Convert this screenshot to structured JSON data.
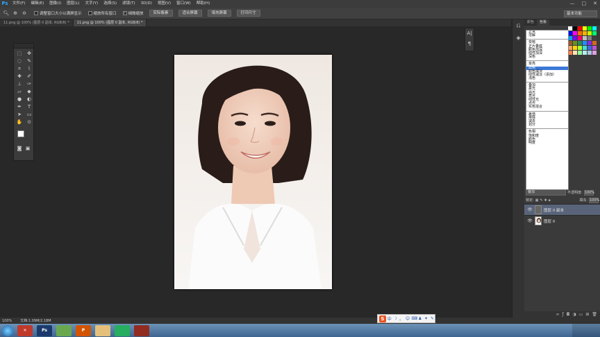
{
  "app": {
    "logo": "Ps"
  },
  "menu": [
    "文件(F)",
    "编辑(E)",
    "图像(I)",
    "图层(L)",
    "文字(Y)",
    "选择(S)",
    "滤镜(T)",
    "3D(D)",
    "视图(V)",
    "窗口(W)",
    "帮助(H)"
  ],
  "window_controls": {
    "minimize": "—",
    "maximize": "□",
    "close": "✕"
  },
  "options": {
    "check1": "调整窗口大小以满屏显示",
    "check2": "缩放所有窗口",
    "check3": "细微缩放",
    "btn1": "实际像素",
    "btn2": "适合屏幕",
    "btn3": "填充屏幕",
    "btn4": "打印尺寸",
    "workspace": "基本功能"
  },
  "tabs": [
    "11.png @ 100% (图层 0 副本, RGB/8) *",
    "11.png @ 100% (图层 0 副本, RGB/8) *"
  ],
  "strip": {
    "a": "A|",
    "b": "¶"
  },
  "right_panel": {
    "tab1": "颜色",
    "tab2": "色板"
  },
  "swatch_colors": [
    "#ffffff",
    "#000000",
    "#ff0000",
    "#ffff00",
    "#00ff00",
    "#00ffff",
    "#0000ff",
    "#ff00ff",
    "#ff6f00",
    "#ffb000",
    "#c7ff00",
    "#00ff6a",
    "#00a2ff",
    "#7a00ff",
    "#ff0066",
    "#c0c0c0",
    "#808080",
    "#404040",
    "#9c5a2a",
    "#6b8e23",
    "#2e8b57",
    "#1e90ff",
    "#8a2be2",
    "#d2691e",
    "#f4a460",
    "#ffd700",
    "#adff2f",
    "#40e0d0",
    "#4169e1",
    "#ba55d3",
    "#ff7f50",
    "#ffe4b5",
    "#98fb98",
    "#afeeee",
    "#b0c4de",
    "#dda0dd"
  ],
  "blend_groups": [
    [
      "正常",
      "溶解"
    ],
    [
      "变暗",
      "正片叠底",
      "颜色加深",
      "线性加深",
      "深色"
    ],
    [
      "变亮",
      "滤色",
      "颜色减淡",
      "线性减淡（添加）",
      "浅色"
    ],
    [
      "叠加",
      "柔光",
      "强光",
      "亮光",
      "线性光",
      "点光",
      "实色混合"
    ],
    [
      "差值",
      "排除",
      "减去",
      "划分"
    ],
    [
      "色相",
      "饱和度",
      "颜色",
      "明度"
    ]
  ],
  "blend_selected": "滤色",
  "layers": {
    "blend_mode": "叠加",
    "opacity_label": "不透明度:",
    "opacity": "100%",
    "lock_label": "锁定:",
    "fill_label": "填充:",
    "fill": "100%",
    "items": [
      {
        "name": "图层 0 副本",
        "active": true
      },
      {
        "name": "图层 0",
        "active": false
      }
    ]
  },
  "status": {
    "zoom": "100%",
    "doc": "文档:1.09M/2.18M"
  },
  "ime": {
    "logo": "S",
    "mode": "中"
  },
  "taskbar": [
    {
      "label": "✕",
      "color": "#c0392b"
    },
    {
      "label": "Ps",
      "color": "#1b3a6b"
    },
    {
      "label": "",
      "color": "#6aa84f"
    },
    {
      "label": "P",
      "color": "#d35400"
    },
    {
      "label": "",
      "color": "#e5c07b"
    },
    {
      "label": "",
      "color": "#27ae60"
    },
    {
      "label": "",
      "color": "#922b21"
    }
  ]
}
